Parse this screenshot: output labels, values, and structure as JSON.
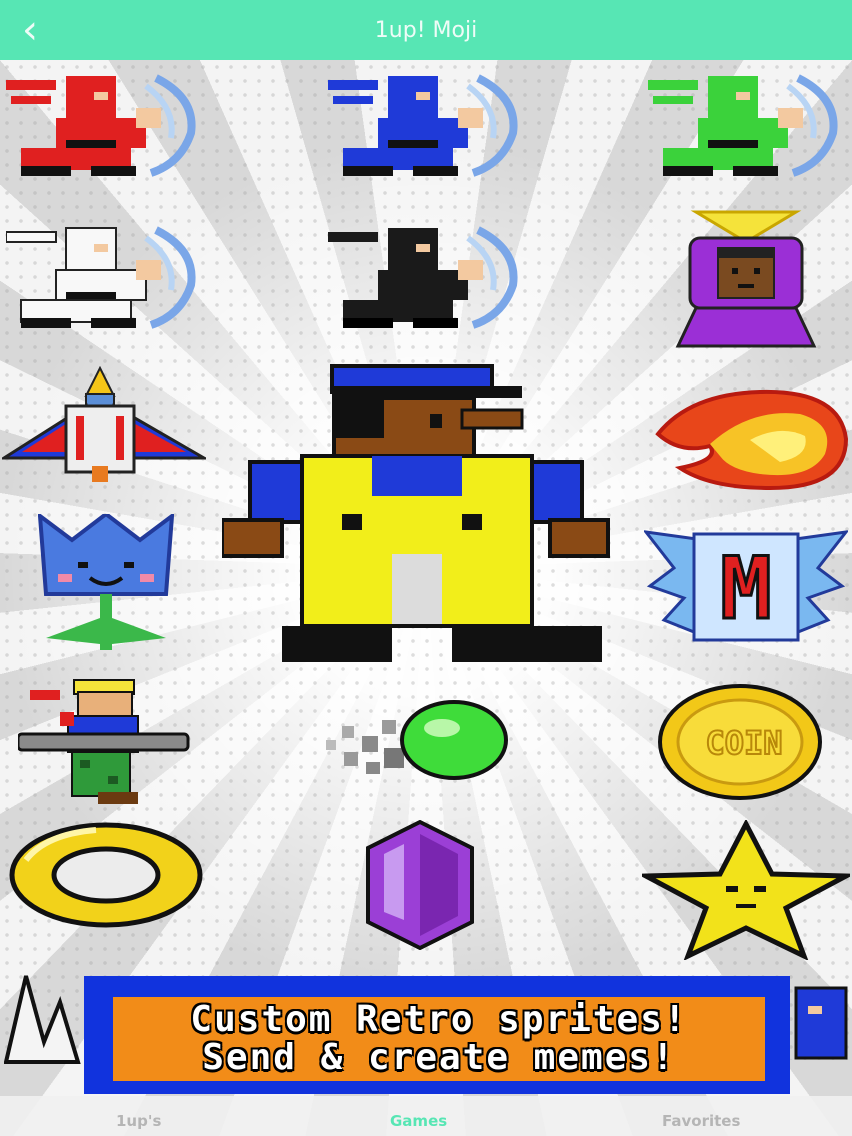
{
  "header": {
    "title": "1up! Moji",
    "back_icon": "chevron-left-icon"
  },
  "banner": {
    "line1": "Custom Retro sprites!",
    "line2": "Send & create memes!"
  },
  "tabs": [
    {
      "label": "1up's",
      "active": false
    },
    {
      "label": "Games",
      "active": true
    },
    {
      "label": "Favorites",
      "active": false
    }
  ],
  "colors": {
    "accent": "#57e6b4",
    "banner_bg": "#f28c18",
    "banner_border": "#1133dd"
  },
  "sprites": [
    "red-ninja",
    "blue-ninja",
    "green-ninja",
    "white-ninja",
    "black-ninja",
    "purple-wizard",
    "spaceship",
    "plumber-hero",
    "fireball",
    "blue-flower",
    "m-emblem",
    "commando-soldier",
    "green-gem-shot",
    "gold-coin",
    "gold-ring",
    "purple-crystal",
    "gold-star"
  ],
  "coin_text": "COIN",
  "emblem_letter": "M"
}
